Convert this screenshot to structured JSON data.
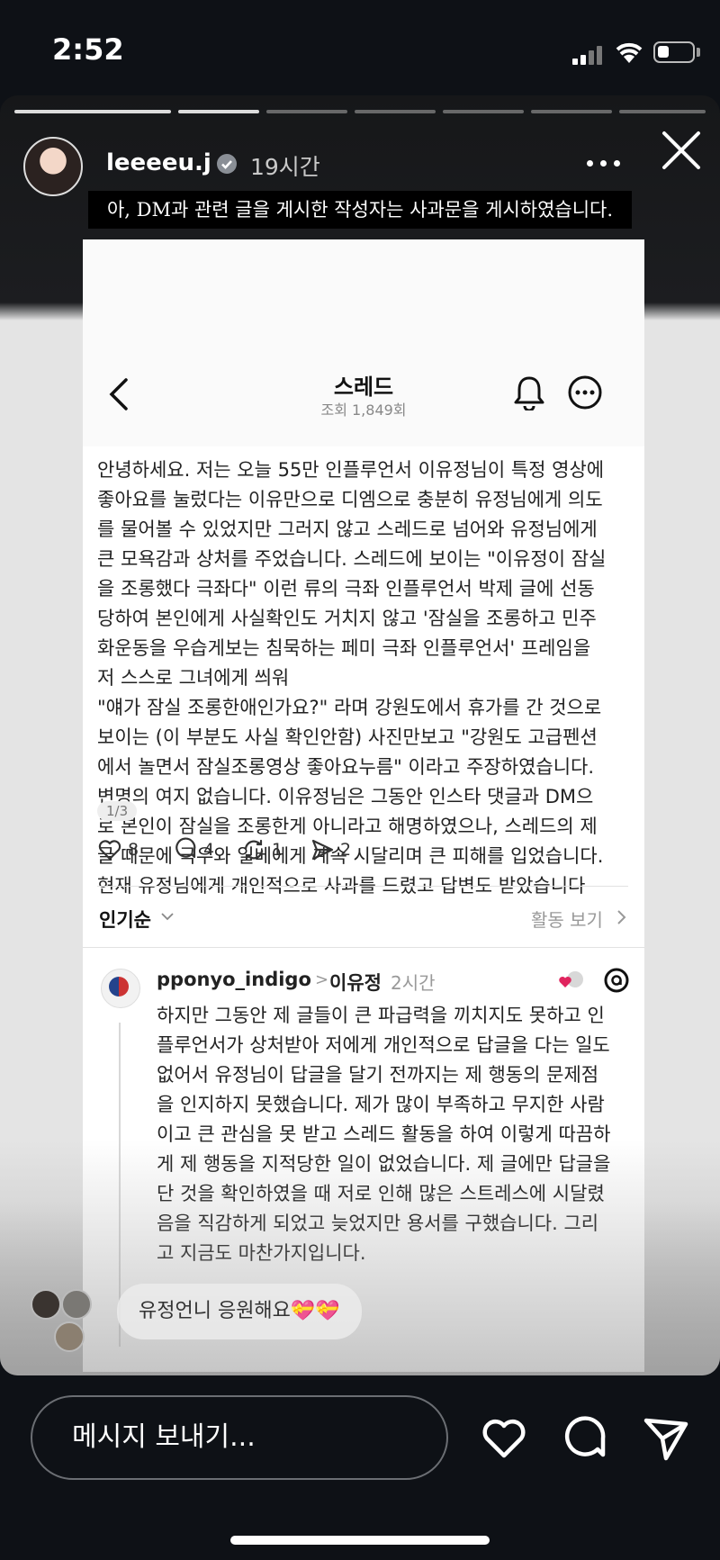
{
  "status_bar": {
    "time": "2:52"
  },
  "story": {
    "username": "leeeeu.j",
    "time_ago": "19시간",
    "caption": "아, DM과 관련 글을 게시한 작성자는 사과문을 게시하였습니다."
  },
  "threads": {
    "title": "스레드",
    "views": "조회 1,849회",
    "post_text": "안녕하세요. 저는 오늘 55만 인플루언서 이유정님이 특정 영상에\n좋아요를 눌렀다는 이유만으로 디엠으로 충분히 유정님에게 의도\n를 물어볼 수 있었지만 그러지 않고 스레드로 넘어와 유정님에게\n큰 모욕감과 상처를 주었습니다. 스레드에 보이는 \"이유정이 잠실\n을 조롱했다 극좌다\" 이런 류의 극좌 인플루언서 박제 글에 선동\n당하여 본인에게 사실확인도 거치지 않고 '잠실을 조롱하고 민주\n화운동을 우습게보는 침묵하는 페미 극좌 인플루언서'  프레임을\n저 스스로 그녀에게 씌워\n\"얘가 잠실 조롱한애인가요?\" 라며 강원도에서 휴가를 간 것으로\n보이는 (이 부분도 사실 확인안함) 사진만보고 \"강원도 고급펜션\n에서 놀면서 잠실조롱영상 좋아요누름\" 이라고 주장하였습니다.\n변명의 여지 없습니다. 이유정님은 그동안 인스타 댓글과 DM으\n로 본인이 잠실을 조롱한게 아니라고 해명하였으나, 스레드의 제\n글 때문에 극우와 일베에게 계속 시달리며 큰 피해를 입었습니다.\n현재 유정님에게 개인적으로 사과를 드렸고 답변도 받았습니다",
    "page_indicator": "1/3",
    "likes": "8",
    "comments": "4",
    "reposts": "1",
    "shares": "2",
    "sort_label": "인기순",
    "activity_label": "활동 보기",
    "reply": {
      "username": "pponyo_indigo",
      "arrow": ">",
      "reply_to": "이유정",
      "time": "2시간",
      "text": "하지만 그동안 제 글들이 큰 파급력을 끼치지도 못하고 인\n플루언서가 상처받아 저에게 개인적으로 답글을 다는 일도\n없어서 유정님이 답글을 달기 전까지는 제 행동의 문제점\n을 인지하지 못했습니다. 제가 많이 부족하고 무지한 사람\n이고 큰 관심을 못 받고 스레드 활동을 하여 이렇게 따끔하\n게 제 행동을 지적당한 일이 없었습니다. 제 글에만 답글을\n단 것을 확인하였을 때 저로 인해 많은 스트레스에 시달렸\n음을 직감하게 되었고 늦었지만 용서를 구했습니다. 그리\n고 지금도 마찬가지입니다."
    }
  },
  "comment_bubble": "유정언니 응원해요💝💝",
  "message_placeholder": "메시지 보내기...",
  "colors": {
    "background": "#0e1116",
    "caption_bg": "#000000",
    "verified": "#3897f0"
  }
}
